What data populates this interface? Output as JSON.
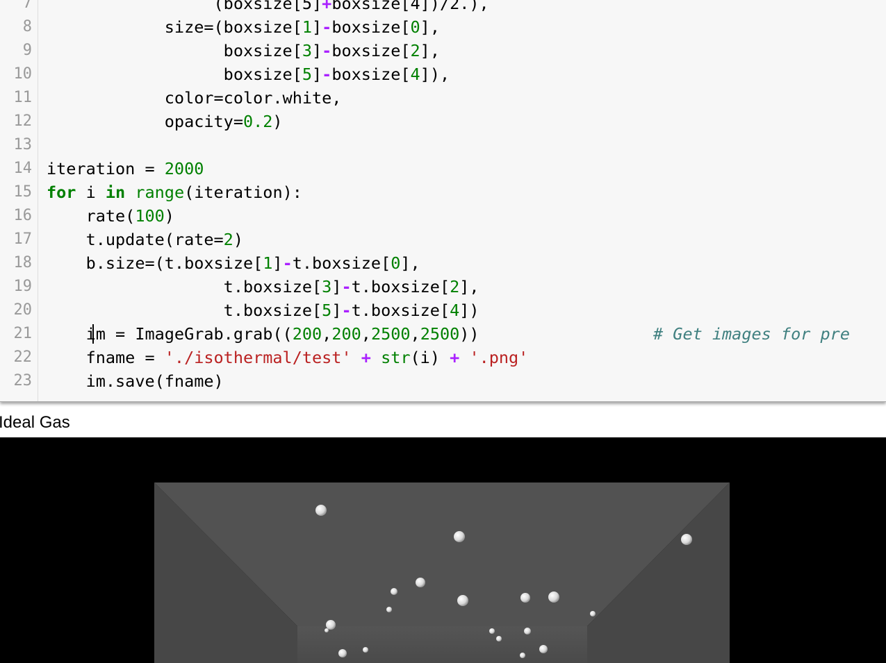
{
  "editor": {
    "lines": [
      {
        "number": "7",
        "tokens": [
          {
            "t": "                 (boxsize[5]"
          },
          {
            "t": "+",
            "c": "op"
          },
          {
            "t": "boxsize[4])/2.),"
          }
        ]
      },
      {
        "number": "8",
        "tokens": [
          {
            "t": "            size=(boxsize["
          },
          {
            "t": "1",
            "c": "num"
          },
          {
            "t": "]"
          },
          {
            "t": "-",
            "c": "op"
          },
          {
            "t": "boxsize["
          },
          {
            "t": "0",
            "c": "num"
          },
          {
            "t": "],"
          }
        ]
      },
      {
        "number": "9",
        "tokens": [
          {
            "t": "                  boxsize["
          },
          {
            "t": "3",
            "c": "num"
          },
          {
            "t": "]"
          },
          {
            "t": "-",
            "c": "op"
          },
          {
            "t": "boxsize["
          },
          {
            "t": "2",
            "c": "num"
          },
          {
            "t": "],"
          }
        ]
      },
      {
        "number": "10",
        "tokens": [
          {
            "t": "                  boxsize["
          },
          {
            "t": "5",
            "c": "num"
          },
          {
            "t": "]"
          },
          {
            "t": "-",
            "c": "op"
          },
          {
            "t": "boxsize["
          },
          {
            "t": "4",
            "c": "num"
          },
          {
            "t": "]),"
          }
        ]
      },
      {
        "number": "11",
        "tokens": [
          {
            "t": "            color=color.white,"
          }
        ]
      },
      {
        "number": "12",
        "tokens": [
          {
            "t": "            opacity="
          },
          {
            "t": "0.2",
            "c": "num"
          },
          {
            "t": ")"
          }
        ]
      },
      {
        "number": "13",
        "tokens": []
      },
      {
        "number": "14",
        "tokens": [
          {
            "t": "iteration = "
          },
          {
            "t": "2000",
            "c": "num"
          }
        ]
      },
      {
        "number": "15",
        "tokens": [
          {
            "t": "for",
            "c": "kw"
          },
          {
            "t": " i "
          },
          {
            "t": "in",
            "c": "kw"
          },
          {
            "t": " "
          },
          {
            "t": "range",
            "c": "builtin"
          },
          {
            "t": "(iteration):"
          }
        ]
      },
      {
        "number": "16",
        "tokens": [
          {
            "t": "    rate("
          },
          {
            "t": "100",
            "c": "num"
          },
          {
            "t": ")"
          }
        ]
      },
      {
        "number": "17",
        "tokens": [
          {
            "t": "    t.update(rate="
          },
          {
            "t": "2",
            "c": "num"
          },
          {
            "t": ")"
          }
        ]
      },
      {
        "number": "18",
        "tokens": [
          {
            "t": "    b.size=(t.boxsize["
          },
          {
            "t": "1",
            "c": "num"
          },
          {
            "t": "]"
          },
          {
            "t": "-",
            "c": "op"
          },
          {
            "t": "t.boxsize["
          },
          {
            "t": "0",
            "c": "num"
          },
          {
            "t": "],"
          }
        ]
      },
      {
        "number": "19",
        "tokens": [
          {
            "t": "                  t.boxsize["
          },
          {
            "t": "3",
            "c": "num"
          },
          {
            "t": "]"
          },
          {
            "t": "-",
            "c": "op"
          },
          {
            "t": "t.boxsize["
          },
          {
            "t": "2",
            "c": "num"
          },
          {
            "t": "],"
          }
        ]
      },
      {
        "number": "20",
        "tokens": [
          {
            "t": "                  t.boxsize["
          },
          {
            "t": "5",
            "c": "num"
          },
          {
            "t": "]"
          },
          {
            "t": "-",
            "c": "op"
          },
          {
            "t": "t.boxsize["
          },
          {
            "t": "4",
            "c": "num"
          },
          {
            "t": "])"
          }
        ]
      },
      {
        "number": "21",
        "tokens": [
          {
            "t": "    im = ImageGrab.grab(("
          },
          {
            "t": "200",
            "c": "num"
          },
          {
            "t": ","
          },
          {
            "t": "200",
            "c": "num"
          },
          {
            "t": ","
          },
          {
            "t": "2500",
            "c": "num"
          },
          {
            "t": ","
          },
          {
            "t": "2500",
            "c": "num"
          },
          {
            "t": "))"
          }
        ],
        "comment": "# Get images for pre",
        "cursor": true
      },
      {
        "number": "22",
        "tokens": [
          {
            "t": "    fname = "
          },
          {
            "t": "'./isothermal/test'",
            "c": "str"
          },
          {
            "t": " "
          },
          {
            "t": "+",
            "c": "op"
          },
          {
            "t": " "
          },
          {
            "t": "str",
            "c": "builtin"
          },
          {
            "t": "(i) "
          },
          {
            "t": "+",
            "c": "op"
          },
          {
            "t": " "
          },
          {
            "t": "'.png'",
            "c": "str"
          }
        ]
      },
      {
        "number": "23",
        "tokens": [
          {
            "t": "    im.save(fname)"
          }
        ]
      }
    ]
  },
  "output": {
    "title": "Ideal Gas"
  },
  "scene": {
    "background_color": "#000000",
    "box_color": "#4a4a4a",
    "particle_color": "#f0f0f0"
  }
}
